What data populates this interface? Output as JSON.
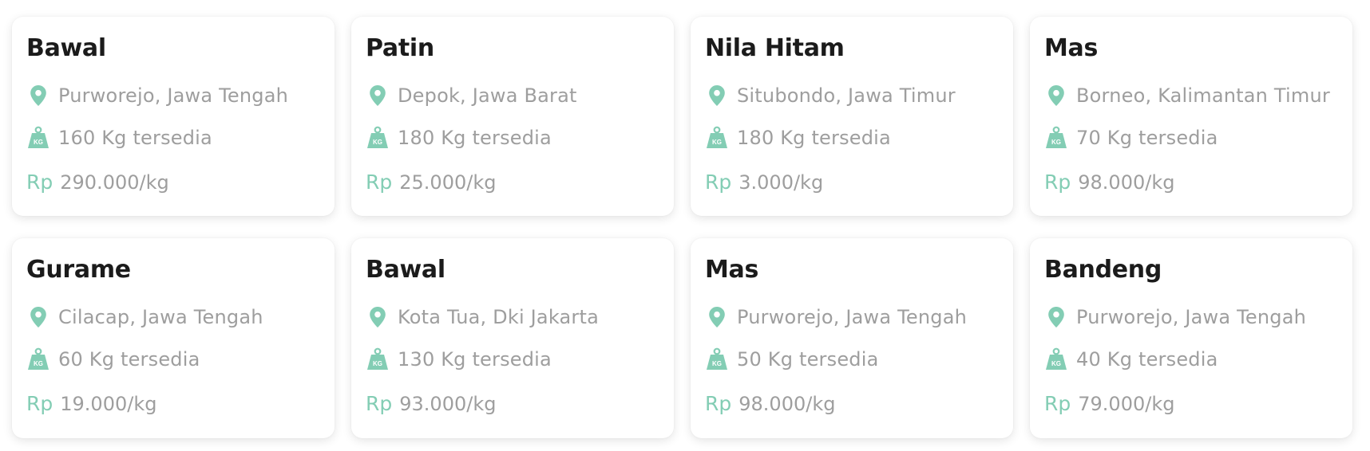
{
  "accent_color": "#83cdb4",
  "icons": {
    "location": "map-pin-icon",
    "weight": "kg-weight-icon"
  },
  "currency_label": "Rp",
  "cards": [
    {
      "name": "Bawal",
      "location": "Purworejo, Jawa Tengah",
      "stock": "160 Kg tersedia",
      "price": "290.000/kg"
    },
    {
      "name": "Patin",
      "location": "Depok, Jawa Barat",
      "stock": "180 Kg tersedia",
      "price": "25.000/kg"
    },
    {
      "name": "Nila Hitam",
      "location": "Situbondo, Jawa Timur",
      "stock": "180 Kg tersedia",
      "price": "3.000/kg"
    },
    {
      "name": "Mas",
      "location": "Borneo, Kalimantan Timur",
      "stock": "70 Kg tersedia",
      "price": "98.000/kg"
    },
    {
      "name": "Gurame",
      "location": "Cilacap, Jawa Tengah",
      "stock": "60 Kg tersedia",
      "price": "19.000/kg"
    },
    {
      "name": "Bawal",
      "location": "Kota Tua, Dki Jakarta",
      "stock": "130 Kg tersedia",
      "price": "93.000/kg"
    },
    {
      "name": "Mas",
      "location": "Purworejo, Jawa Tengah",
      "stock": "50 Kg tersedia",
      "price": "98.000/kg"
    },
    {
      "name": "Bandeng",
      "location": "Purworejo, Jawa Tengah",
      "stock": "40 Kg tersedia",
      "price": "79.000/kg"
    }
  ]
}
